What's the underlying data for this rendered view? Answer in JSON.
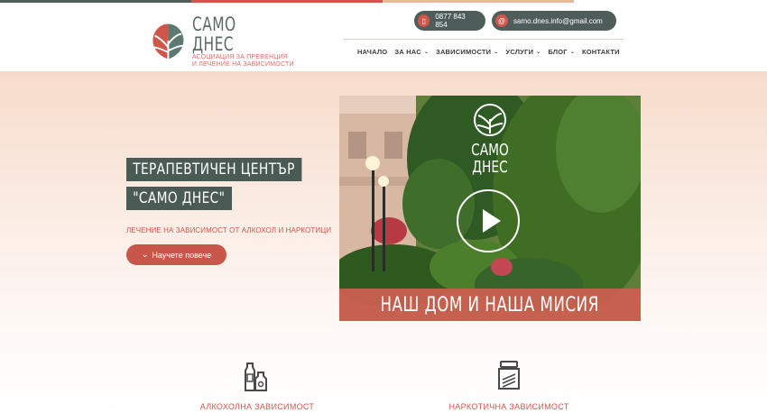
{
  "colors": {
    "accent": "#d0564c",
    "dark": "#4a5a55",
    "top_bar": [
      "#4e5d59",
      "#d0564c",
      "#e8b89a"
    ]
  },
  "logo": {
    "name": "САМО ДНЕС",
    "sub_line1": "АСОЦИАЦИЯ ЗА ПРЕВЕНЦИЯ",
    "sub_line2": "И ЛЕЧЕНИЕ НА ЗАВИСИМОСТИ",
    "icon": "tree-logo-icon"
  },
  "contact": {
    "phone": "0877 843 854",
    "email": "samo.dnes.info@gmail.com"
  },
  "nav": {
    "items": [
      {
        "label": "НАЧАЛО",
        "dropdown": false
      },
      {
        "label": "ЗА НАС",
        "dropdown": true
      },
      {
        "label": "ЗАВИСИМОСТИ",
        "dropdown": true
      },
      {
        "label": "УСЛУГИ",
        "dropdown": true
      },
      {
        "label": "БЛОГ",
        "dropdown": true
      },
      {
        "label": "КОНТАКТИ",
        "dropdown": false
      }
    ]
  },
  "hero": {
    "title_line1": "ТЕРАПЕВТИЧЕН ЦЕНТЪР",
    "title_line2": "\"САМО ДНЕС\"",
    "subtitle": "ЛЕЧЕНИЕ НА ЗАВИСИМОСТ ОТ АЛКОХОЛ И НАРКОТИЦИ",
    "cta": "Научете повече"
  },
  "video": {
    "logo_line1": "САМО",
    "logo_line2": "ДНЕС",
    "banner": "НАШ ДОМ И НАША МИСИЯ"
  },
  "services": [
    {
      "label": "АЛКОХОЛНА ЗАВИСИМОСТ",
      "icon": "bottles-icon"
    },
    {
      "label": "НАРКОТИЧНА ЗАВИСИМОСТ",
      "icon": "pill-jar-icon"
    }
  ]
}
